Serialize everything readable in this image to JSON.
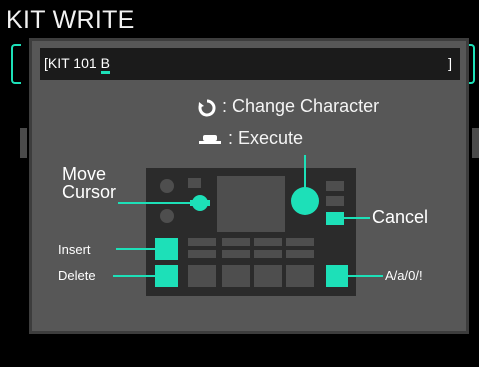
{
  "page": {
    "title": "KIT WRITE"
  },
  "dialog": {
    "name_prefix": "[KIT 101 ",
    "name_cursor_char": "B",
    "name_suffix": "]",
    "legend_dial_label": ": Change Character",
    "legend_button_label": ": Execute",
    "move_cursor_label": "Move Cursor",
    "cancel_label": "Cancel",
    "insert_label": "Insert",
    "delete_label": "Delete",
    "case_label": "A/a/0/!"
  },
  "colors": {
    "accent": "#1de0b8",
    "dialog_bg": "#575757",
    "device_bg": "#2b2b2b",
    "key": "#4e4e4e"
  },
  "icons": {
    "dial": "dial-icon",
    "button": "button-icon"
  }
}
